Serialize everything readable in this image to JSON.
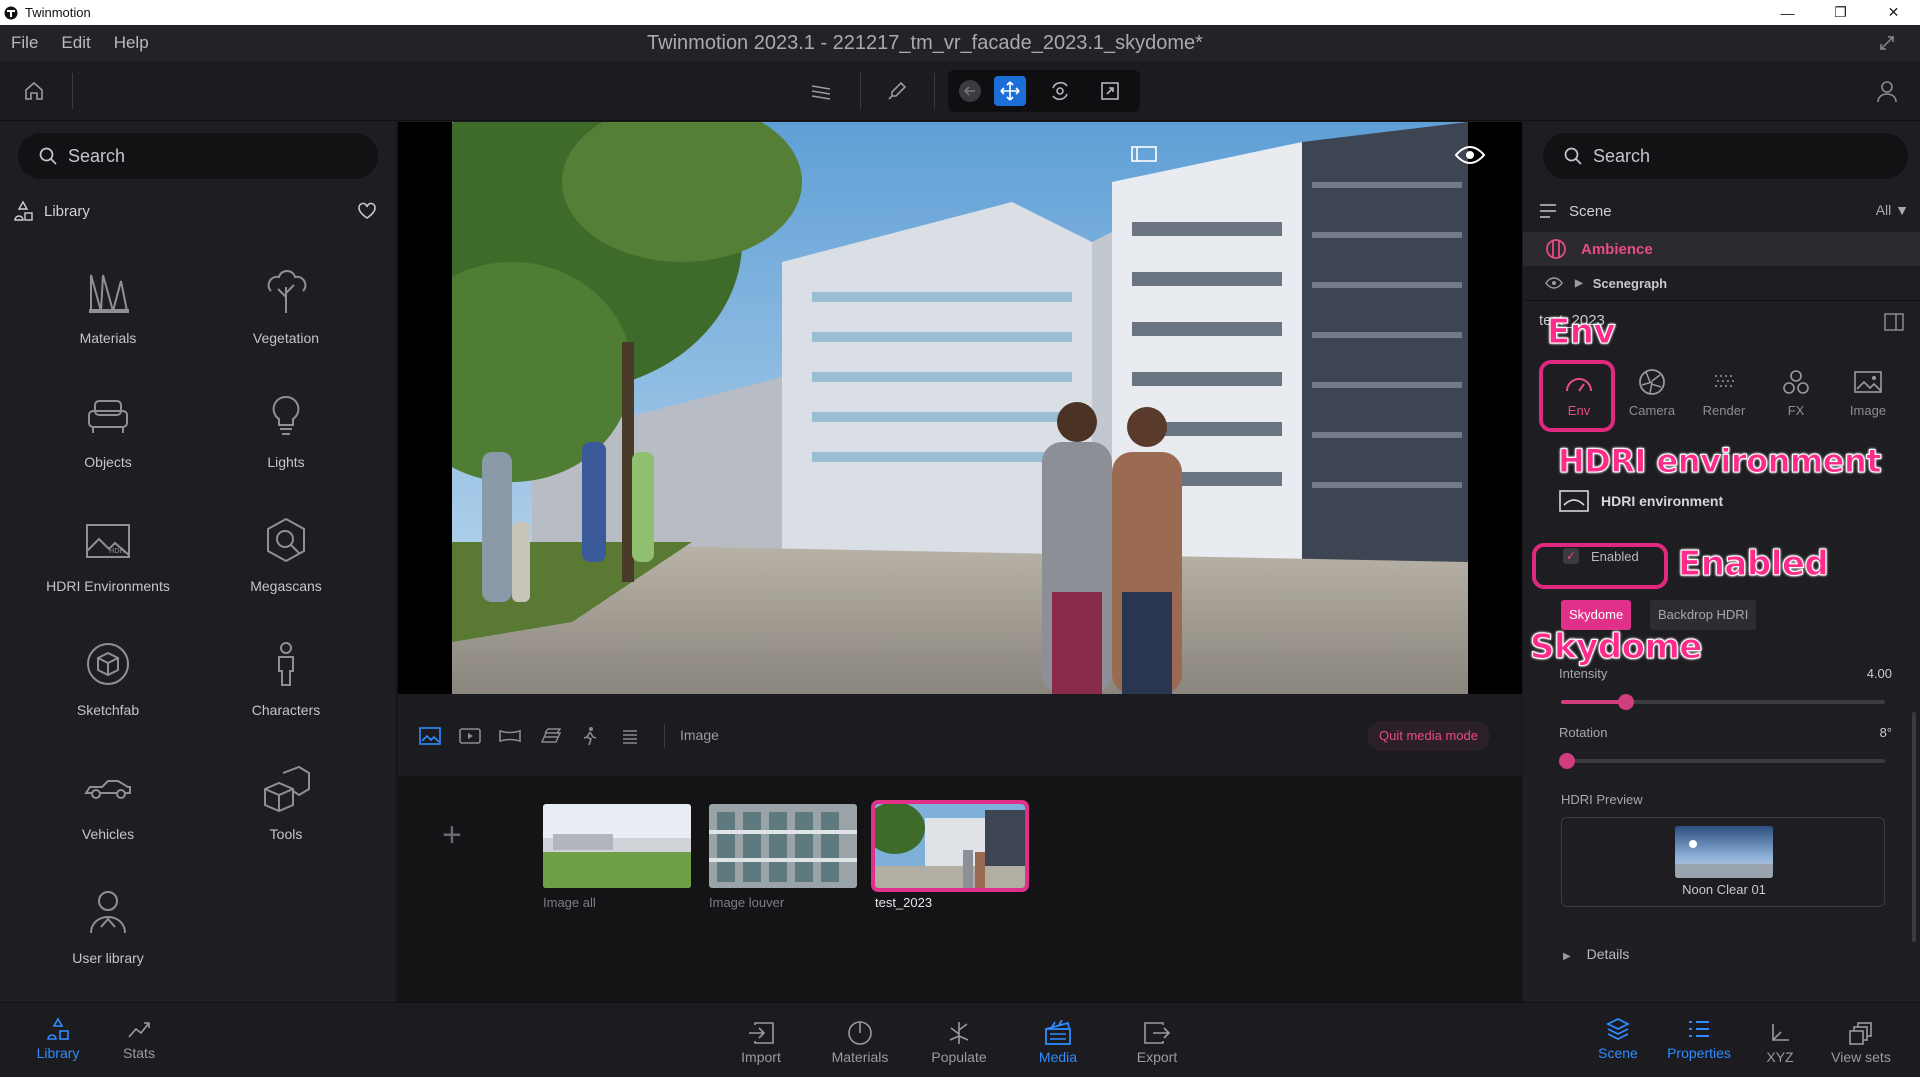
{
  "window": {
    "app_name": "Twinmotion",
    "controls": [
      "—",
      "❐",
      "✕"
    ]
  },
  "menubar": {
    "items": [
      "File",
      "Edit",
      "Help"
    ],
    "document_title": "Twinmotion 2023.1 - 221217_tm_vr_facade_2023.1_skydome*"
  },
  "left_panel": {
    "search_placeholder": "Search",
    "library_title": "Library",
    "items": [
      {
        "label": "Materials",
        "icon": "materials-icon"
      },
      {
        "label": "Vegetation",
        "icon": "vegetation-icon"
      },
      {
        "label": "Objects",
        "icon": "objects-icon"
      },
      {
        "label": "Lights",
        "icon": "lights-icon"
      },
      {
        "label": "HDRI Environments",
        "icon": "hdri-environments-icon"
      },
      {
        "label": "Megascans",
        "icon": "megascans-icon"
      },
      {
        "label": "Sketchfab",
        "icon": "sketchfab-icon"
      },
      {
        "label": "Characters",
        "icon": "characters-icon"
      },
      {
        "label": "Vehicles",
        "icon": "vehicles-icon"
      },
      {
        "label": "Tools",
        "icon": "tools-icon"
      },
      {
        "label": "User library",
        "icon": "user-library-icon"
      }
    ]
  },
  "media": {
    "mode_label": "Image",
    "quit_label": "Quit media mode",
    "thumbnails": [
      {
        "label": "Image all",
        "selected": false
      },
      {
        "label": "Image louver",
        "selected": false
      },
      {
        "label": "test_2023",
        "selected": true
      }
    ]
  },
  "right_panel": {
    "search_placeholder": "Search",
    "scene_label": "Scene",
    "filter_label": "All",
    "ambience_label": "Ambience",
    "scenegraph_label": "Scenegraph",
    "properties_title": "test_2023",
    "tabs": [
      {
        "label": "Env",
        "active": true
      },
      {
        "label": "Camera",
        "active": false
      },
      {
        "label": "Render",
        "active": false
      },
      {
        "label": "FX",
        "active": false
      },
      {
        "label": "Image",
        "active": false
      }
    ],
    "hdri_section_label": "HDRI environment",
    "enabled_label": "Enabled",
    "enabled": true,
    "segments": [
      "Skydome",
      "Backdrop HDRI"
    ],
    "intensity_label": "Intensity",
    "intensity_value": "4.00",
    "intensity_fraction": 0.2,
    "rotation_label": "Rotation",
    "rotation_value": "8°",
    "rotation_fraction": 0.02,
    "preview_label": "HDRI Preview",
    "preview_name": "Noon Clear 01",
    "details_label": "Details"
  },
  "annotations": {
    "env": "Env",
    "hdri": "HDRI environment",
    "enabled": "Enabled",
    "skydome": "Skydome"
  },
  "bottombar": {
    "left": [
      {
        "label": "Library",
        "active": true
      },
      {
        "label": "Stats",
        "active": false
      }
    ],
    "center": [
      {
        "label": "Import",
        "active": false
      },
      {
        "label": "Materials",
        "active": false
      },
      {
        "label": "Populate",
        "active": false
      },
      {
        "label": "Media",
        "active": true
      },
      {
        "label": "Export",
        "active": false
      }
    ],
    "right": [
      {
        "label": "Scene",
        "active": true
      },
      {
        "label": "Properties",
        "active": true
      },
      {
        "label": "XYZ",
        "active": false
      },
      {
        "label": "View sets",
        "active": false
      }
    ]
  },
  "colors": {
    "accent_pink": "#e0308a",
    "accent_blue": "#2f8cff"
  }
}
